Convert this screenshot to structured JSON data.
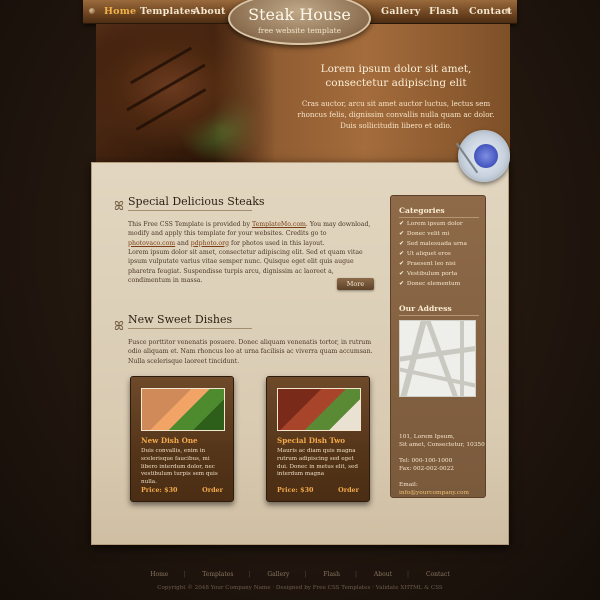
{
  "nav": {
    "left": [
      "Home",
      "Templates",
      "About"
    ],
    "right": [
      "Gallery",
      "Flash",
      "Contact"
    ]
  },
  "logo": {
    "title": "Steak House",
    "subtitle": "free website template"
  },
  "header": {
    "headline": "Lorem ipsum dolor sit amet, consectetur adipiscing elit",
    "text": "Cras auctor, arcu sit amet auctor luctus, lectus sem rhoncus felis, dignissim convallis nulla quam ac dolor. Duis sollicitudin libero et odio."
  },
  "special": {
    "title": "Special Delicious Steaks",
    "p1_pre": "This Free CSS Template is provided by ",
    "p1_link1": "TemplateMo.com",
    "p1_mid": ". You may download, modify and apply this template for your websites. Credits go to ",
    "p1_link2": "photovaco.com",
    "p1_and": " and ",
    "p1_link3": "pdphoto.org",
    "p1_post": " for photos used in this layout.",
    "p2": "Lorem ipsum dolor sit amet, consectetur adipiscing elit. Sed et quam vitae ipsum vulputate varius vitae semper nunc. Quisque eget elit quis augue pharetra feugiat. Suspendisse turpis arcu, dignissim ac laoreet a, condimentum in massa.",
    "more_label": "More"
  },
  "sweet": {
    "title": "New Sweet Dishes",
    "text": "Fusce porttitor venenatis posuere. Donec aliquam venenatis tortor, in rutrum odio aliquam et. Nam rhoncus leo at urna facilisis ac viverra quam accumsan. Nulla scelerisque laoreet tincidunt."
  },
  "dishes": [
    {
      "title": "New Dish One",
      "text": "Duis convallis, enim in scelerisque faucibus, mi libero interdum dolor, nec vestibulum turpis sem quis nulla.",
      "price": "Price: $30",
      "order": "Order"
    },
    {
      "title": "Special Dish Two",
      "text": "Mauris ac diam quis magna rutrum adipiscing sed eget dui. Donec in metus elit, sed interdum magna",
      "price": "Price: $30",
      "order": "Order"
    }
  ],
  "sidebar": {
    "categories_title": "Categories",
    "categories": [
      "Lorem ipsum dolor",
      "Donec velit mi",
      "Sed malesuada urna",
      "Ut aliquet eros",
      "Praesent leo nisi",
      "Vestibulum porta",
      "Donec elementum"
    ],
    "address_title": "Our Address",
    "address_line1": "101, Lorem Ipsum,",
    "address_line2": "Sit amet, Consectetur, 10350",
    "tel": "Tel: 000-100-1000",
    "fax": "Fax: 002-002-0022",
    "email_label": "Email:",
    "email": "info@yourcompany.com"
  },
  "footer": {
    "links": [
      "Home",
      "Templates",
      "Gallery",
      "Flash",
      "About",
      "Contact"
    ],
    "copyright": "Copyright © 2048 Your Company Name · Designed by Free CSS Templates · Validate XHTML & CSS"
  },
  "colors": {
    "accent_orange": "#f4a94b",
    "nav_active": "#f0b24a",
    "panel_bg": "#e2d6c0",
    "card_bg": "#553519",
    "sidebar_bg": "#8e6a48"
  }
}
